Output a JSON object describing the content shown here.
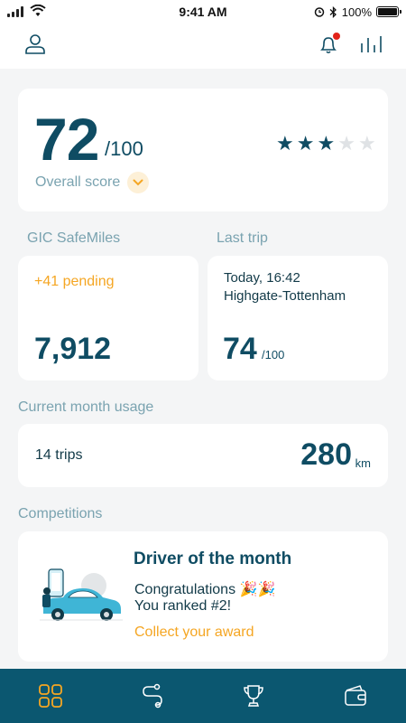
{
  "status_bar": {
    "time": "9:41 AM",
    "battery": "100%"
  },
  "header": {
    "icons": [
      "user-icon",
      "bell-icon",
      "stats-icon"
    ],
    "has_notification": true
  },
  "overall": {
    "score": "72",
    "denominator": "/100",
    "label": "Overall score",
    "stars_filled": 3,
    "stars_total": 5
  },
  "safemiles": {
    "section_label": "GIC SafeMiles",
    "pending": "+41 pending",
    "value": "7,912"
  },
  "last_trip": {
    "section_label": "Last trip",
    "date": "Today, 16:42",
    "route": "Highgate-Tottenham",
    "score": "74",
    "denominator": "/100"
  },
  "usage": {
    "section_label": "Current month usage",
    "trips": "14 trips",
    "distance": "280",
    "unit": "km"
  },
  "competitions": {
    "section_label": "Competitions",
    "title": "Driver of the month",
    "message_line1": "Congratulations 🎉🎉",
    "message_line2": "You ranked #2!",
    "link": "Collect your award"
  },
  "nav": {
    "items": [
      "dashboard-icon",
      "route-icon",
      "trophy-icon",
      "wallet-icon"
    ],
    "active": "dashboard-icon"
  },
  "colors": {
    "primary": "#0f4c63",
    "accent": "#f5a623",
    "muted": "#7aa3b0",
    "nav_bg": "#0b5770"
  }
}
